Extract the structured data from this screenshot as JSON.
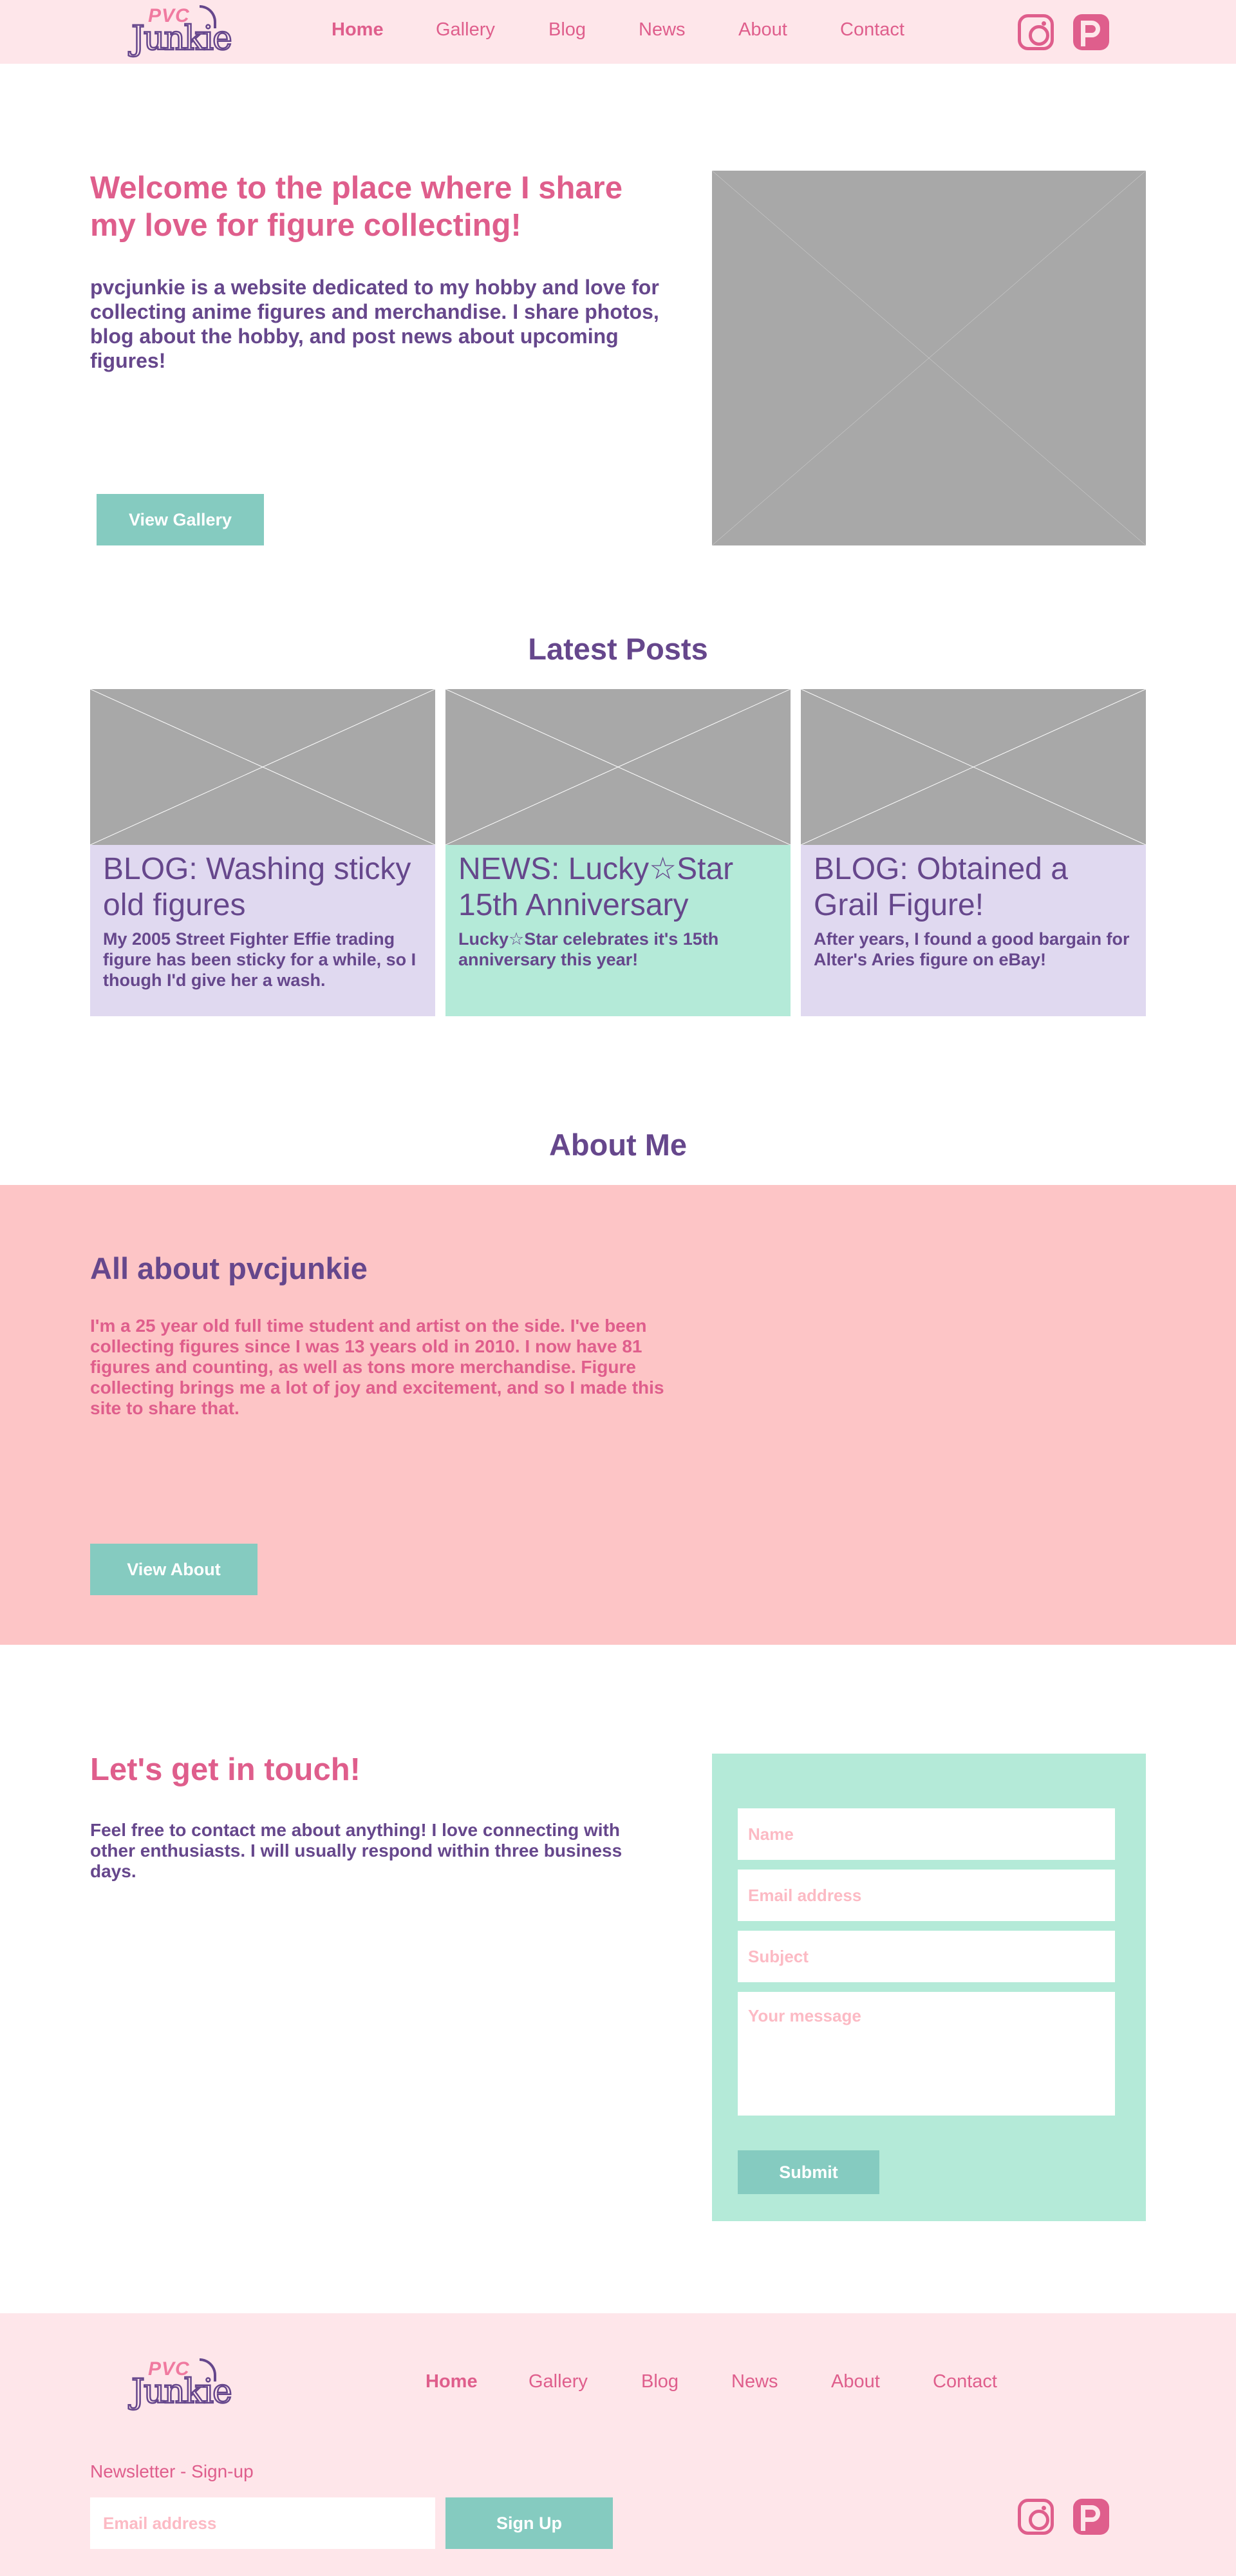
{
  "brand": {
    "logo_top": "PVC",
    "logo_bottom": "Junkie"
  },
  "nav": {
    "items": [
      {
        "label": "Home",
        "active": true
      },
      {
        "label": "Gallery",
        "active": false
      },
      {
        "label": "Blog",
        "active": false
      },
      {
        "label": "News",
        "active": false
      },
      {
        "label": "About",
        "active": false
      },
      {
        "label": "Contact",
        "active": false
      }
    ]
  },
  "social": {
    "icons": [
      "instagram-icon",
      "patreon-icon"
    ]
  },
  "hero": {
    "title": "Welcome to the place where I share my love for figure collecting!",
    "text": "pvcjunkie is a website dedicated to my hobby and love for collecting anime figures and merchandise. I share photos, blog about the hobby, and post news about upcoming figures!",
    "button": "View Gallery"
  },
  "posts": {
    "heading": "Latest Posts",
    "items": [
      {
        "title": "BLOG: Washing sticky old figures",
        "text": "My 2005 Street Fighter Effie trading figure has been sticky for a while, so I though I'd give her a wash."
      },
      {
        "title": "NEWS: Lucky☆Star 15th Anniversary",
        "text": "Lucky☆Star celebrates it's 15th anniversary this year!"
      },
      {
        "title": "BLOG: Obtained a Grail Figure!",
        "text": "After years, I found a good bargain for Alter's Aries figure on eBay!"
      }
    ]
  },
  "about": {
    "heading": "About Me",
    "title": "All about pvcjunkie",
    "text": "I'm a 25 year old full time student and artist on the side. I've been collecting figures since I was 13 years old in 2010. I now have 81 figures and counting, as well as tons more merchandise. Figure collecting brings me a lot of joy and excitement, and so I made this site to share that.",
    "button": "View About"
  },
  "contact": {
    "title": "Let's get in touch!",
    "text": "Feel free to contact me about anything! I love connecting with other enthusiasts. I will usually respond within three business days.",
    "name_placeholder": "Name",
    "email_placeholder": "Email address",
    "subject_placeholder": "Subject",
    "message_placeholder": "Your message",
    "submit": "Submit"
  },
  "footer": {
    "newsletter_label": "Newsletter - Sign-up",
    "email_placeholder": "Email address",
    "signup_button": "Sign Up"
  },
  "colors": {
    "pink": "#df5e8c",
    "purple": "#66478c",
    "teal": "#85cbc0",
    "mint": "#b4ead8",
    "lavender": "#e0d9f0",
    "header_bg": "#fee6ea",
    "about_bg": "#fdc5c6"
  }
}
